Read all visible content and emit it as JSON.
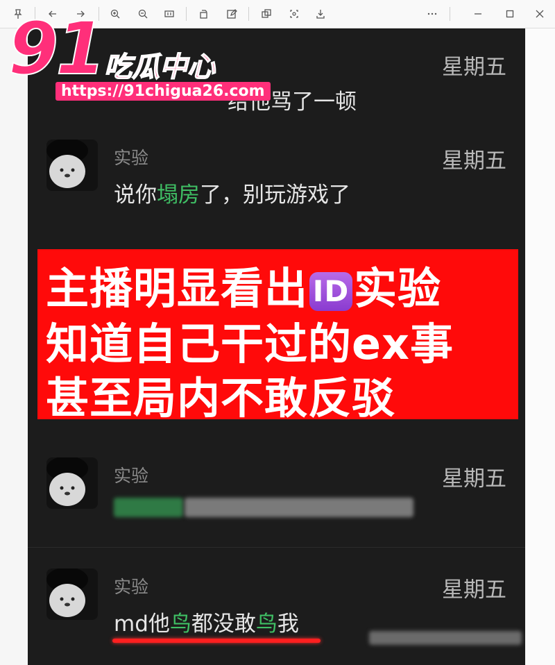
{
  "watermark": {
    "number": "91",
    "title": "吃瓜中心",
    "url": "https://91chigua26.com"
  },
  "chat": {
    "messages": [
      {
        "sender": "",
        "day": "星期五",
        "text_parts": [
          "给他骂了一顿"
        ]
      },
      {
        "sender": "实验",
        "day": "星期五",
        "text_parts": [
          "说你",
          "塌房",
          "了，别玩游戏了"
        ]
      },
      {
        "sender": "实验",
        "day": "星期五",
        "text_parts": []
      },
      {
        "sender": "实验",
        "day": "星期五",
        "text_parts": [
          "md他",
          "鸟",
          "都没敢",
          "鸟",
          "我"
        ]
      }
    ]
  },
  "banner": {
    "line1_prefix": "主播明显看出",
    "line1_emoji": "ID",
    "line1_suffix": "实验",
    "line2": "知道自己干过的ex事",
    "line3": "甚至局内不敢反驳"
  },
  "colors": {
    "highlight": "#3fbf64",
    "banner": "#ff0a0a",
    "watermark": "#ff2f7a"
  },
  "toolbar_icons": [
    "pin-icon",
    "back-icon",
    "forward-icon",
    "zoom-in-icon",
    "zoom-out-icon",
    "fit-icon",
    "rotate-icon",
    "edit-icon",
    "copy-icon",
    "crop-icon",
    "save-icon",
    "more-icon",
    "minimize-icon",
    "maximize-icon",
    "close-icon"
  ]
}
